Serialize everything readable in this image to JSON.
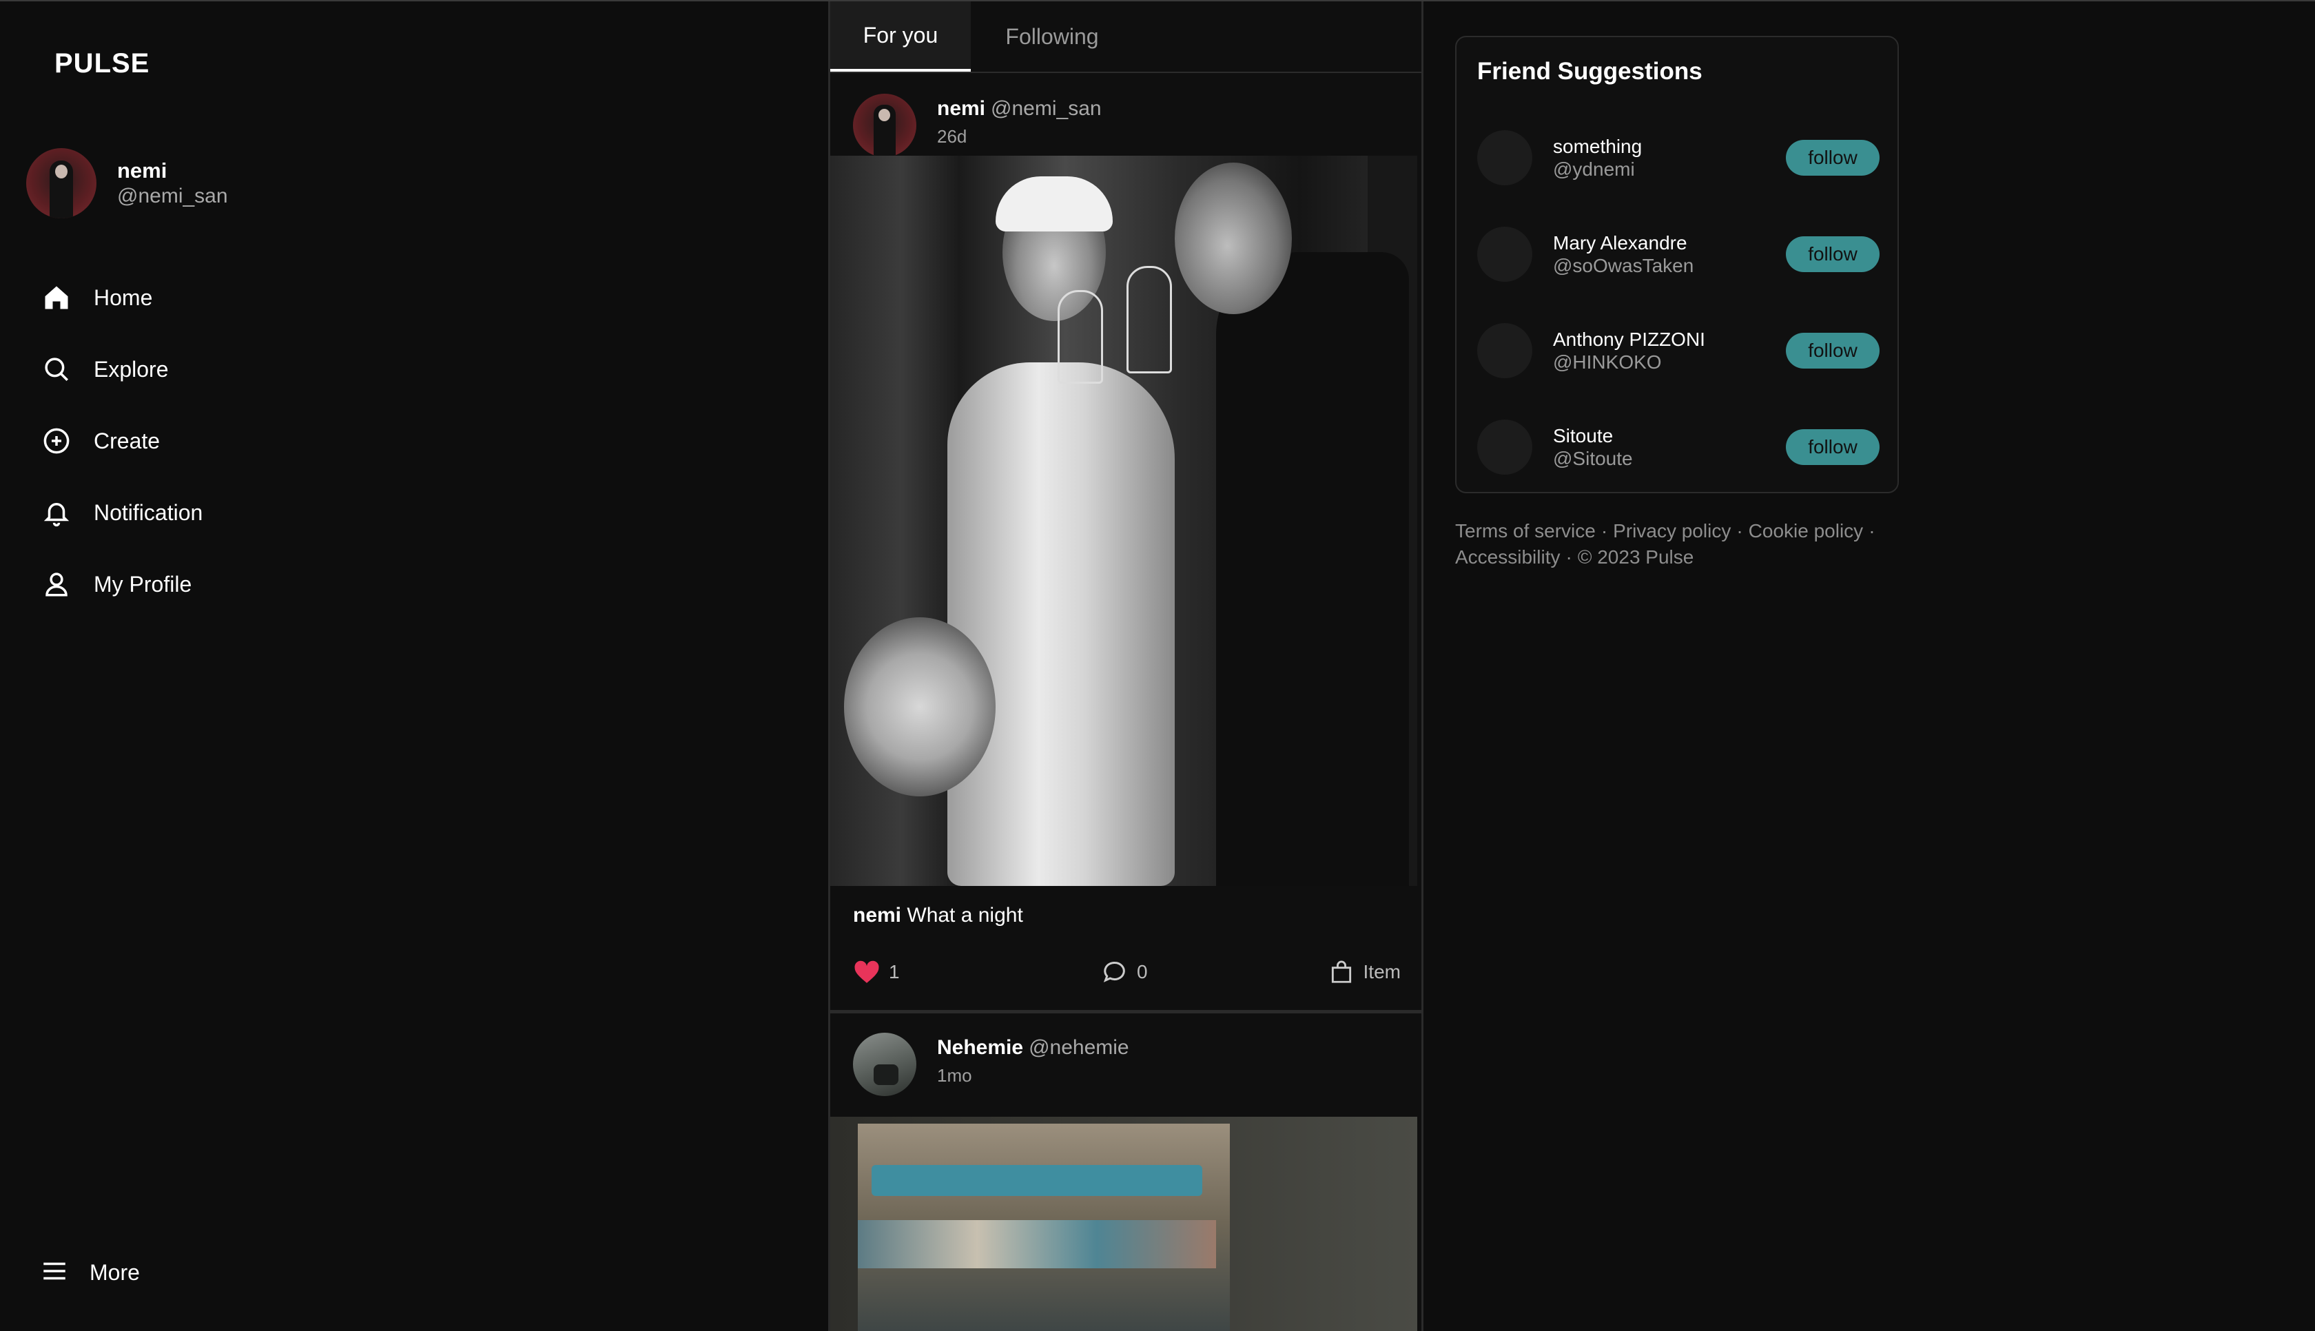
{
  "app": {
    "logo": "PULSE"
  },
  "me": {
    "name": "nemi",
    "handle": "@nemi_san"
  },
  "nav": {
    "items": [
      {
        "label": "Home",
        "icon": "home-icon"
      },
      {
        "label": "Explore",
        "icon": "search-icon"
      },
      {
        "label": "Create",
        "icon": "plus-circle-icon"
      },
      {
        "label": "Notification",
        "icon": "bell-icon"
      },
      {
        "label": "My Profile",
        "icon": "user-icon"
      }
    ],
    "more_label": "More"
  },
  "tabs": [
    {
      "label": "For you",
      "active": true
    },
    {
      "label": "Following",
      "active": false
    }
  ],
  "posts": [
    {
      "name": "nemi",
      "handle": "@nemi_san",
      "time": "26d",
      "caption_user": "nemi",
      "caption_text": "What a night",
      "likes": "1",
      "comments": "0",
      "item_label": "Item"
    },
    {
      "name": "Nehemie",
      "handle": "@nehemie",
      "time": "1mo"
    }
  ],
  "suggestions": {
    "title": "Friend Suggestions",
    "follow_label": "follow",
    "people": [
      {
        "name": "something",
        "handle": "@ydnemi"
      },
      {
        "name": "Mary Alexandre",
        "handle": "@soOwasTaken"
      },
      {
        "name": "Anthony PIZZONI",
        "handle": "@HINKOKO"
      },
      {
        "name": "Sitoute",
        "handle": "@Sitoute"
      }
    ]
  },
  "footer": {
    "terms": "Terms of service",
    "privacy": "Privacy policy",
    "cookie": "Cookie policy",
    "accessibility": "Accessibility",
    "copyright": "© 2023 Pulse",
    "separator": "·"
  },
  "colors": {
    "accent": "#3a8f91",
    "like": "#e8345a",
    "background": "#0d0d0d"
  }
}
